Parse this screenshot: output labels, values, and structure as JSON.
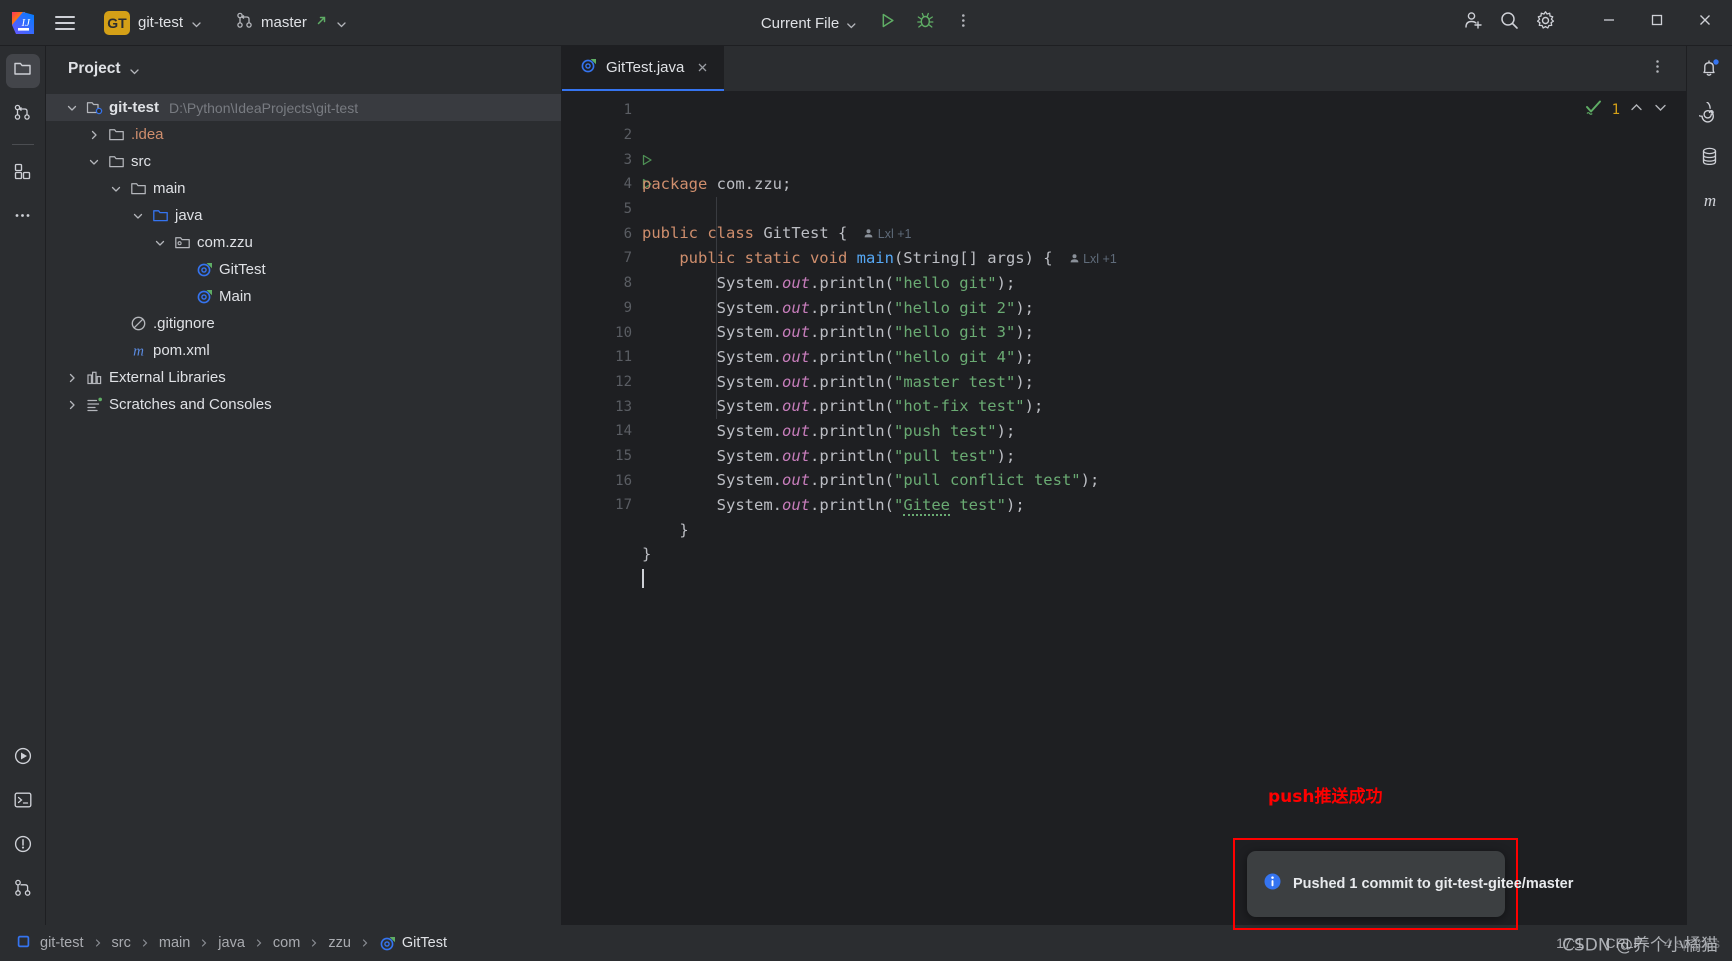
{
  "titlebar": {
    "menu_icon": "hamburger-menu-icon",
    "logo_icon": "intellij-idea-logo",
    "project_badge": "GT",
    "project_name": "git-test",
    "branch_icon": "git-branch-icon",
    "branch_name": "master",
    "branch_push_icon": "push-arrow-icon",
    "run_config": "Current File",
    "run_icon": "run-icon",
    "debug_icon": "debug-icon",
    "more_icon": "more-vertical-icon",
    "share_icon": "add-user-icon",
    "search_icon": "search-icon",
    "settings_icon": "gear-icon",
    "minimize": "minimize-icon",
    "maximize": "maximize-icon",
    "close": "close-icon"
  },
  "leftstrip": {
    "items": [
      {
        "name": "project-tool-window",
        "icon": "folder-icon",
        "active": true
      },
      {
        "name": "commit-tool-window",
        "icon": "git-commit-icon",
        "active": false
      },
      {
        "name": "structure-tool-window",
        "icon": "structure-blocks-icon",
        "active": false
      },
      {
        "name": "more-tool-windows",
        "icon": "more-horizontal-icon",
        "active": false
      }
    ],
    "bottom": [
      {
        "name": "run-tool-window",
        "icon": "run-circle-icon"
      },
      {
        "name": "terminal-tool-window",
        "icon": "terminal-icon"
      },
      {
        "name": "problems-tool-window",
        "icon": "warning-circle-icon"
      },
      {
        "name": "version-control-tool-window",
        "icon": "git-vcs-icon"
      }
    ]
  },
  "rightstrip": {
    "items": [
      {
        "name": "notifications",
        "icon": "bell-icon",
        "badge": true
      },
      {
        "name": "ai-assistant",
        "icon": "spiral-icon",
        "badge": false
      },
      {
        "name": "database",
        "icon": "database-icon",
        "badge": false
      },
      {
        "name": "maven",
        "icon": "maven-m-icon",
        "badge": false
      }
    ]
  },
  "project_panel": {
    "title": "Project",
    "chevron_icon": "chevron-down-icon",
    "tree": [
      {
        "label": "git-test",
        "path": "D:\\Python\\IdeaProjects\\git-test",
        "icon": "project-folder-icon",
        "depth": 0,
        "expanded": true,
        "selected": true,
        "bold": true
      },
      {
        "label": ".idea",
        "icon": "folder-icon",
        "depth": 1,
        "expanded": false,
        "orange": true
      },
      {
        "label": "src",
        "icon": "folder-icon",
        "depth": 1,
        "expanded": true
      },
      {
        "label": "main",
        "icon": "folder-icon",
        "depth": 2,
        "expanded": true
      },
      {
        "label": "java",
        "icon": "source-folder-icon",
        "depth": 3,
        "expanded": true
      },
      {
        "label": "com.zzu",
        "icon": "package-icon",
        "depth": 4,
        "expanded": true
      },
      {
        "label": "GitTest",
        "icon": "java-class-run-icon",
        "depth": 5,
        "leaf": true
      },
      {
        "label": "Main",
        "icon": "java-class-run-icon",
        "depth": 5,
        "leaf": true
      },
      {
        "label": ".gitignore",
        "icon": "gitignore-icon",
        "depth": 2,
        "leaf": true
      },
      {
        "label": "pom.xml",
        "icon": "maven-m-icon",
        "depth": 2,
        "leaf": true
      },
      {
        "label": "External Libraries",
        "icon": "libraries-icon",
        "depth": 0,
        "expanded": false
      },
      {
        "label": "Scratches and Consoles",
        "icon": "scratches-icon",
        "depth": 0,
        "expanded": false
      }
    ]
  },
  "editor": {
    "tab": {
      "label": "GitTest.java",
      "icon": "java-class-run-icon",
      "close_icon": "close-icon"
    },
    "options_icon": "more-vertical-icon",
    "inspection": {
      "icon": "inspection-check-icon",
      "count": "1",
      "up_icon": "chevron-up-icon",
      "down_icon": "chevron-down-icon"
    },
    "lines": [
      {
        "n": "1",
        "tokens": [
          {
            "t": "package ",
            "c": "kw"
          },
          {
            "t": "com.zzu;",
            "c": "plain"
          }
        ]
      },
      {
        "n": "2",
        "tokens": []
      },
      {
        "n": "3",
        "run": true,
        "tokens": [
          {
            "t": "public class ",
            "c": "kw"
          },
          {
            "t": "GitTest {",
            "c": "plain"
          }
        ],
        "hint": "Lxl +1"
      },
      {
        "n": "4",
        "run": true,
        "tokens": [
          {
            "t": "    public static void ",
            "c": "kw"
          },
          {
            "t": "main",
            "c": "fn"
          },
          {
            "t": "(String[] args) {",
            "c": "plain"
          }
        ],
        "hint": "Lxl +1"
      },
      {
        "n": "5",
        "tokens": [
          {
            "t": "        System.",
            "c": "plain"
          },
          {
            "t": "out",
            "c": "field"
          },
          {
            "t": ".println(",
            "c": "plain"
          },
          {
            "t": "\"hello git\"",
            "c": "str"
          },
          {
            "t": ");",
            "c": "plain"
          }
        ]
      },
      {
        "n": "6",
        "tokens": [
          {
            "t": "        System.",
            "c": "plain"
          },
          {
            "t": "out",
            "c": "field"
          },
          {
            "t": ".println(",
            "c": "plain"
          },
          {
            "t": "\"hello git 2\"",
            "c": "str"
          },
          {
            "t": ");",
            "c": "plain"
          }
        ]
      },
      {
        "n": "7",
        "tokens": [
          {
            "t": "        System.",
            "c": "plain"
          },
          {
            "t": "out",
            "c": "field"
          },
          {
            "t": ".println(",
            "c": "plain"
          },
          {
            "t": "\"hello git 3\"",
            "c": "str"
          },
          {
            "t": ");",
            "c": "plain"
          }
        ]
      },
      {
        "n": "8",
        "tokens": [
          {
            "t": "        System.",
            "c": "plain"
          },
          {
            "t": "out",
            "c": "field"
          },
          {
            "t": ".println(",
            "c": "plain"
          },
          {
            "t": "\"hello git 4\"",
            "c": "str"
          },
          {
            "t": ");",
            "c": "plain"
          }
        ]
      },
      {
        "n": "9",
        "tokens": [
          {
            "t": "        System.",
            "c": "plain"
          },
          {
            "t": "out",
            "c": "field"
          },
          {
            "t": ".println(",
            "c": "plain"
          },
          {
            "t": "\"master test\"",
            "c": "str"
          },
          {
            "t": ");",
            "c": "plain"
          }
        ]
      },
      {
        "n": "10",
        "tokens": [
          {
            "t": "        System.",
            "c": "plain"
          },
          {
            "t": "out",
            "c": "field"
          },
          {
            "t": ".println(",
            "c": "plain"
          },
          {
            "t": "\"hot-fix test\"",
            "c": "str"
          },
          {
            "t": ");",
            "c": "plain"
          }
        ]
      },
      {
        "n": "11",
        "tokens": [
          {
            "t": "        System.",
            "c": "plain"
          },
          {
            "t": "out",
            "c": "field"
          },
          {
            "t": ".println(",
            "c": "plain"
          },
          {
            "t": "\"push test\"",
            "c": "str"
          },
          {
            "t": ");",
            "c": "plain"
          }
        ]
      },
      {
        "n": "12",
        "tokens": [
          {
            "t": "        System.",
            "c": "plain"
          },
          {
            "t": "out",
            "c": "field"
          },
          {
            "t": ".println(",
            "c": "plain"
          },
          {
            "t": "\"pull test\"",
            "c": "str"
          },
          {
            "t": ");",
            "c": "plain"
          }
        ]
      },
      {
        "n": "13",
        "tokens": [
          {
            "t": "        System.",
            "c": "plain"
          },
          {
            "t": "out",
            "c": "field"
          },
          {
            "t": ".println(",
            "c": "plain"
          },
          {
            "t": "\"pull conflict test\"",
            "c": "str"
          },
          {
            "t": ");",
            "c": "plain"
          }
        ]
      },
      {
        "n": "14",
        "tokens": [
          {
            "t": "        System.",
            "c": "plain"
          },
          {
            "t": "out",
            "c": "field"
          },
          {
            "t": ".println(",
            "c": "plain"
          },
          {
            "t": "\"",
            "c": "str"
          },
          {
            "t": "Gitee",
            "c": "str squig"
          },
          {
            "t": " test\"",
            "c": "str"
          },
          {
            "t": ");",
            "c": "plain"
          }
        ]
      },
      {
        "n": "15",
        "tokens": [
          {
            "t": "    }",
            "c": "plain"
          }
        ]
      },
      {
        "n": "16",
        "tokens": [
          {
            "t": "}",
            "c": "plain"
          }
        ]
      },
      {
        "n": "17",
        "caret": true,
        "tokens": []
      }
    ]
  },
  "notification": {
    "annotation": "push推送成功",
    "annotation_color": "#ff0000",
    "info_icon": "info-icon",
    "message": "Pushed 1 commit to git-test-gitee/master"
  },
  "statusbar": {
    "breadcrumbs": [
      {
        "label": "git-test",
        "icon": "module-icon"
      },
      {
        "label": "src"
      },
      {
        "label": "main"
      },
      {
        "label": "java"
      },
      {
        "label": "com"
      },
      {
        "label": "zzu"
      },
      {
        "label": "GitTest",
        "icon": "java-class-run-icon"
      }
    ],
    "caret_position": "17:1",
    "line_separator": "CRLF",
    "indent": "4 spaces",
    "watermark": "CSDN @养个小橘猫"
  }
}
